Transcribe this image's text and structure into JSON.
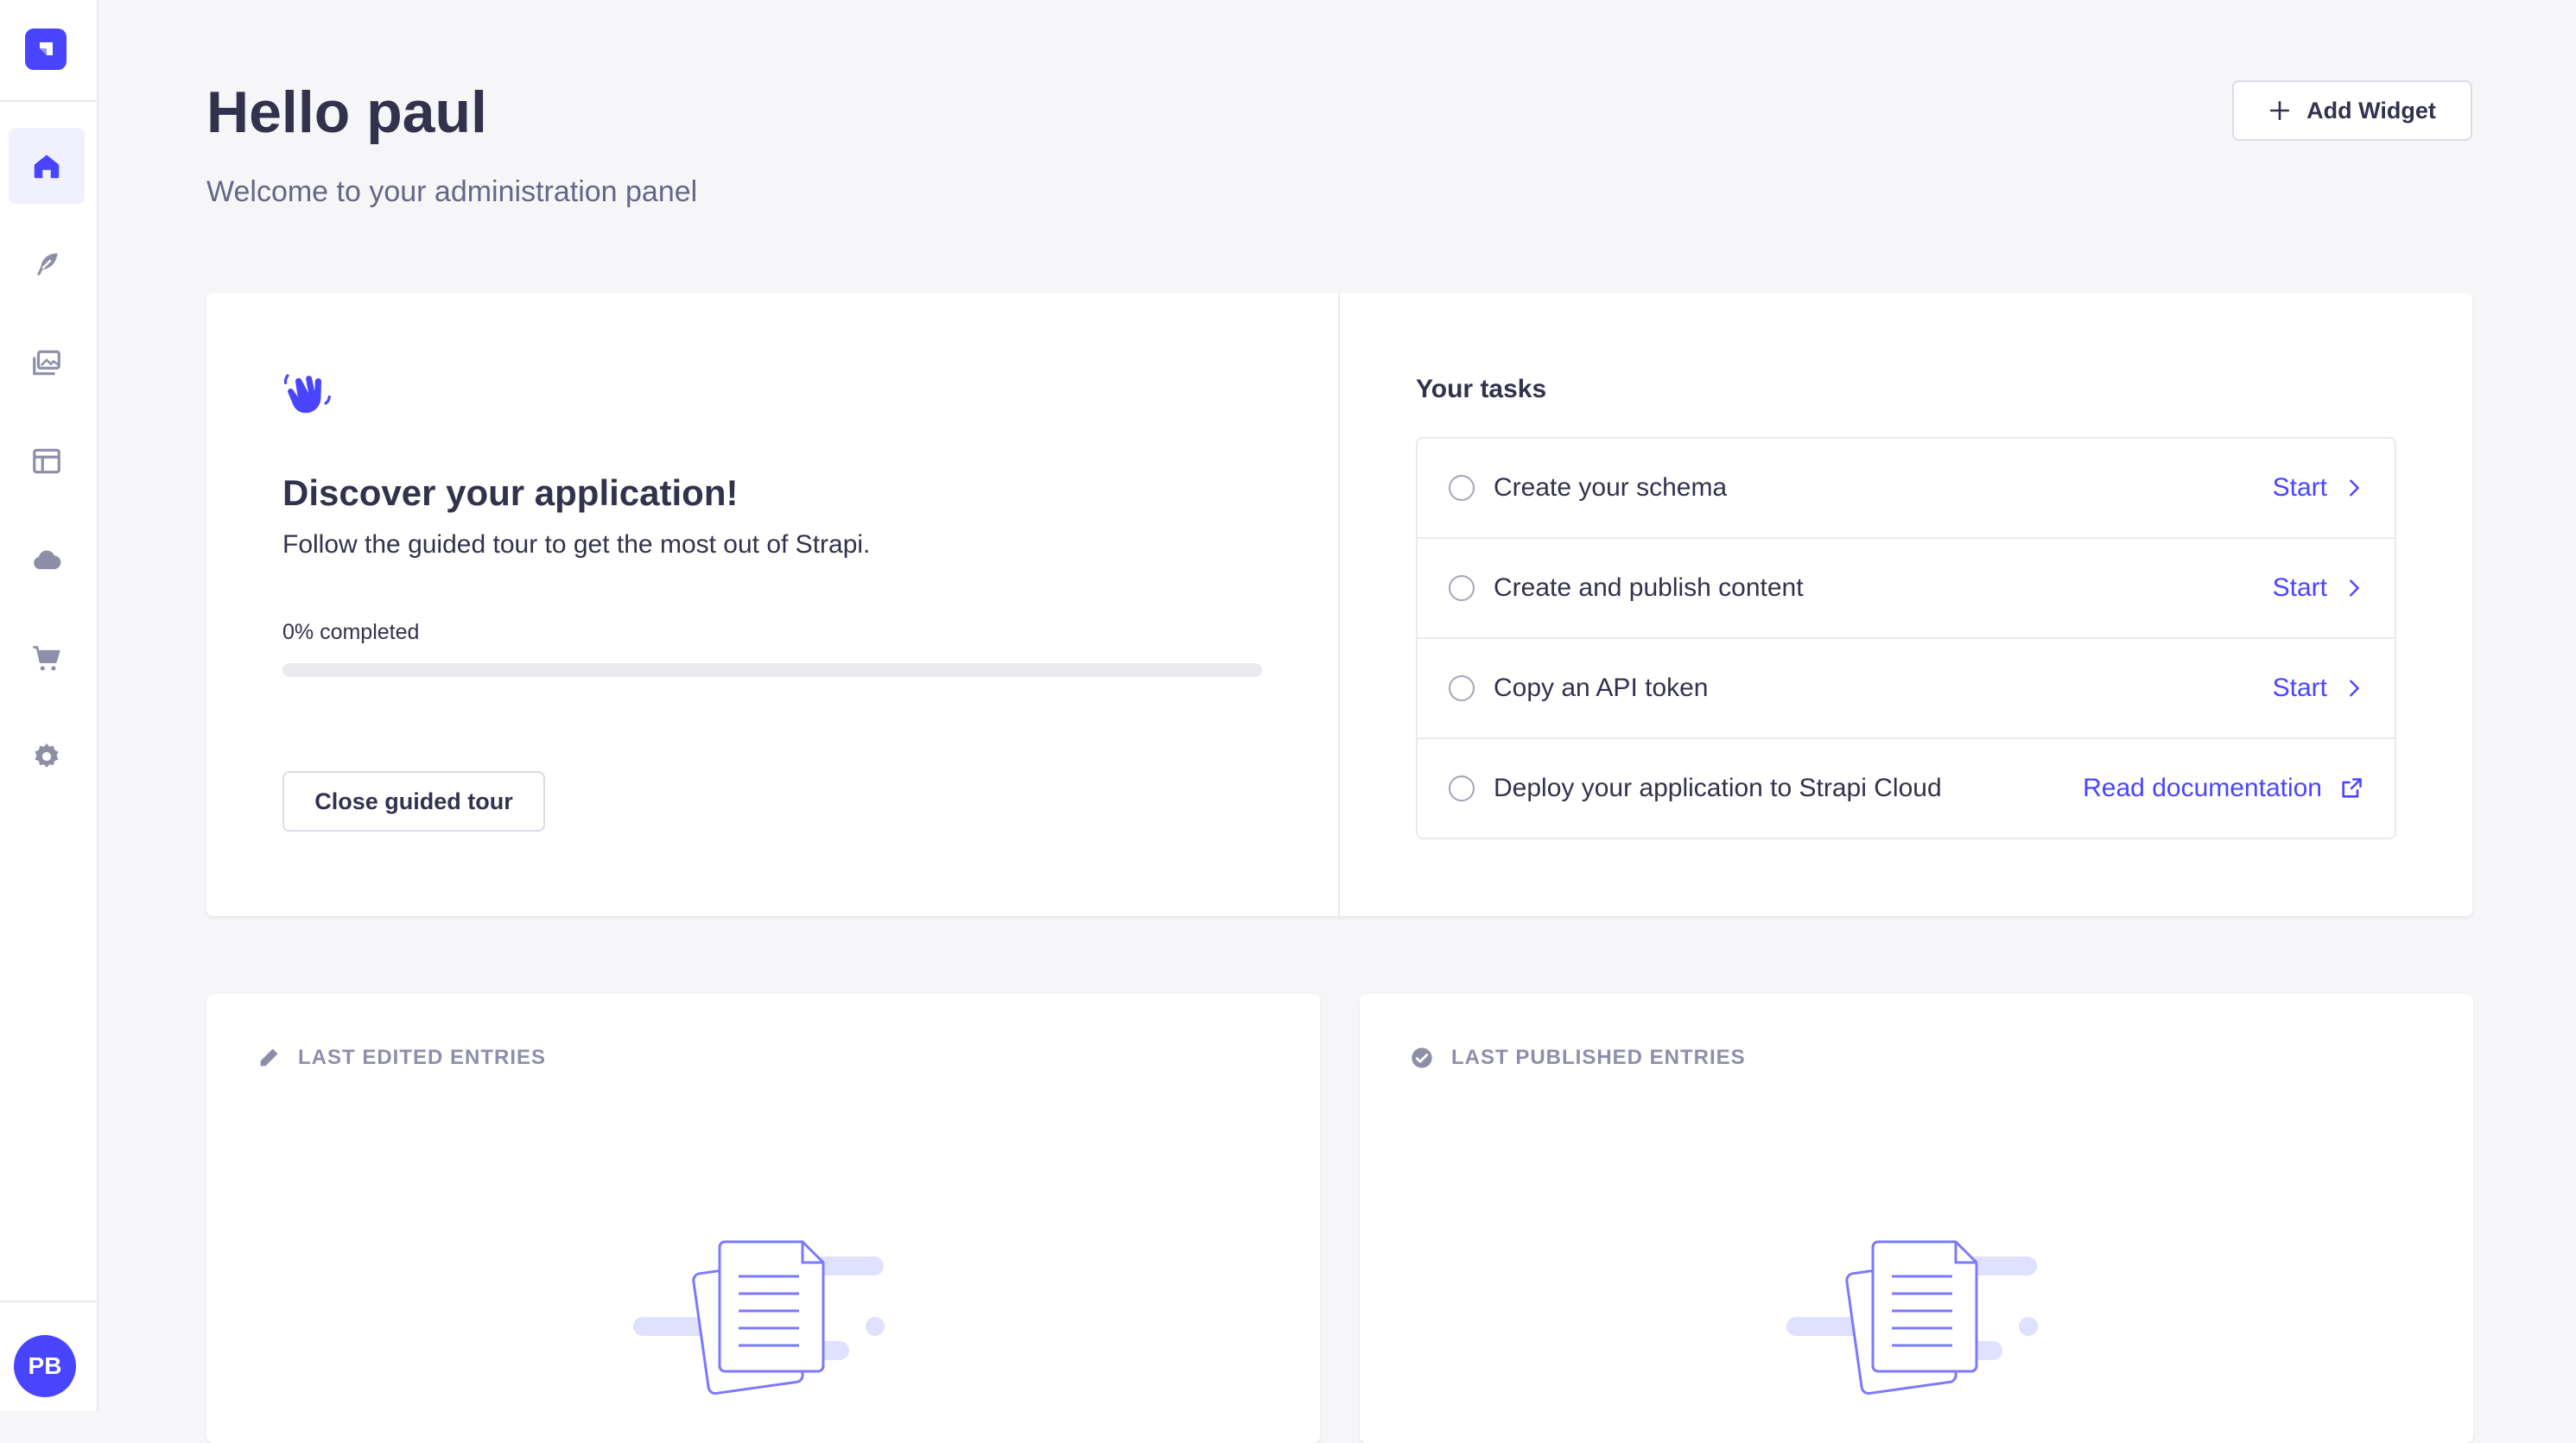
{
  "sidebar": {
    "nav_items": [
      {
        "name": "home",
        "icon": "house-icon",
        "active": true
      },
      {
        "name": "content-manager",
        "icon": "feather-icon"
      },
      {
        "name": "media-library",
        "icon": "images-icon"
      },
      {
        "name": "content-type-builder",
        "icon": "layout-icon"
      },
      {
        "name": "deploy",
        "icon": "cloud-icon"
      },
      {
        "name": "marketplace",
        "icon": "cart-icon"
      },
      {
        "name": "settings",
        "icon": "gear-icon"
      }
    ],
    "user_initials": "PB"
  },
  "header": {
    "title": "Hello paul",
    "subtitle": "Welcome to your administration panel",
    "add_widget_label": "Add Widget"
  },
  "guided_tour": {
    "heading": "Discover your application!",
    "description": "Follow the guided tour to get the most out of Strapi.",
    "progress_label": "0% completed",
    "progress_fraction": 0,
    "close_label": "Close guided tour"
  },
  "tasks": {
    "title": "Your tasks",
    "items": [
      {
        "label": "Create your schema",
        "action": "Start",
        "action_icon": "chevron-right-icon"
      },
      {
        "label": "Create and publish content",
        "action": "Start",
        "action_icon": "chevron-right-icon"
      },
      {
        "label": "Copy an API token",
        "action": "Start",
        "action_icon": "chevron-right-icon"
      },
      {
        "label": "Deploy your application to Strapi Cloud",
        "action": "Read documentation",
        "action_icon": "external-link-icon"
      }
    ]
  },
  "widgets": {
    "last_edited": {
      "title": "LAST EDITED ENTRIES",
      "icon": "pencil-icon"
    },
    "last_published": {
      "title": "LAST PUBLISHED ENTRIES",
      "icon": "check-circle-icon"
    }
  },
  "colors": {
    "primary": "#4945ff",
    "background": "#f6f6f9",
    "text": "#32324d",
    "muted": "#666687"
  }
}
